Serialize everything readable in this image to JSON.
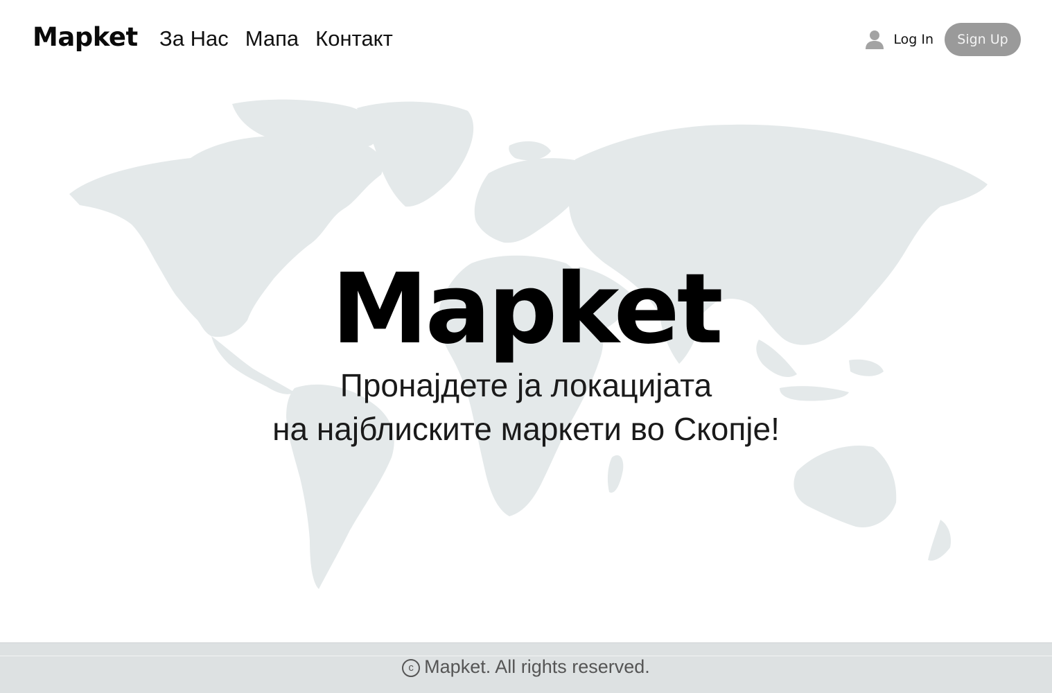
{
  "header": {
    "brand": "Mapket",
    "nav": [
      {
        "label": "За Нас"
      },
      {
        "label": "Мапа"
      },
      {
        "label": "Контакт"
      }
    ],
    "login_label": "Log In",
    "signup_label": "Sign Up"
  },
  "hero": {
    "title": "Mapket",
    "subtitle_line1": "Пронајдете ја локацијата",
    "subtitle_line2": "на најблиските маркети во Скопје!"
  },
  "footer": {
    "copyright_symbol": "c",
    "text": "Mapket. All rights reserved."
  },
  "colors": {
    "map_fill": "#e4e9ea",
    "signup_bg": "#9a9a9a",
    "footer_bg": "#dde1e2"
  },
  "icons": {
    "user": "user-icon",
    "copyright": "copyright-icon"
  }
}
